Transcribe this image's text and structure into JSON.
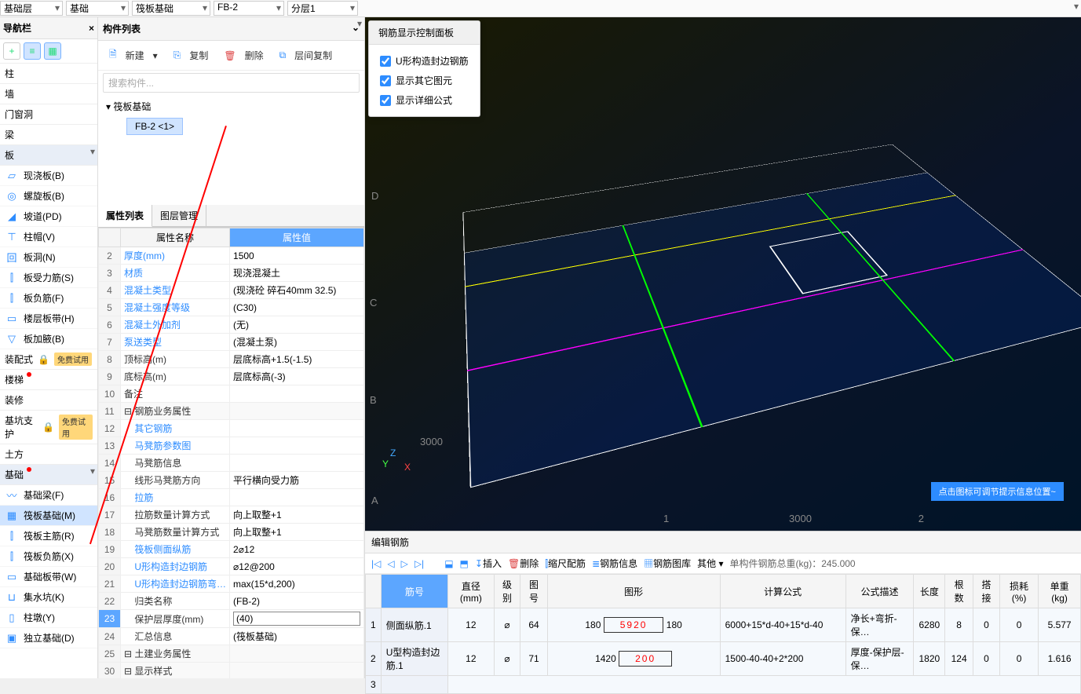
{
  "topbar": {
    "sel1": "基础层",
    "sel2": "基础",
    "sel3": "筏板基础",
    "sel4": "FB-2",
    "sel5": "分层1"
  },
  "nav": {
    "title": "导航栏",
    "cats": {
      "c0": "柱",
      "c1": "墙",
      "c2": "门窗洞",
      "c3": "梁",
      "c4": "板",
      "c5": "装配式",
      "c6": "楼梯",
      "c7": "装修",
      "c8": "基坑支护",
      "c9": "土方",
      "c10": "基础"
    },
    "free": "免费试用",
    "plates": {
      "p0": "现浇板(B)",
      "p1": "螺旋板(B)",
      "p2": "坡道(PD)",
      "p3": "柱帽(V)",
      "p4": "板洞(N)",
      "p5": "板受力筋(S)",
      "p6": "板负筋(F)",
      "p7": "楼层板带(H)",
      "p8": "板加腋(B)"
    },
    "found": {
      "f0": "基础梁(F)",
      "f1": "筏板基础(M)",
      "f2": "筏板主筋(R)",
      "f3": "筏板负筋(X)",
      "f4": "基础板带(W)",
      "f5": "集水坑(K)",
      "f6": "柱墩(Y)",
      "f7": "独立基础(D)"
    }
  },
  "list": {
    "title": "构件列表",
    "new": "新建",
    "copy": "复制",
    "del": "删除",
    "lcopy": "层间复制",
    "search": "搜索构件...",
    "root": "筏板基础",
    "leaf": "FB-2 <1>"
  },
  "prop": {
    "tab1": "属性列表",
    "tab2": "图层管理",
    "colname": "属性名称",
    "colval": "属性值",
    "rows": [
      {
        "n": "2",
        "name": "厚度(mm)",
        "val": "1500",
        "link": 1
      },
      {
        "n": "3",
        "name": "材质",
        "val": "现浇混凝土",
        "link": 1
      },
      {
        "n": "4",
        "name": "混凝土类型",
        "val": "(现浇砼 碎石40mm 32.5)",
        "link": 1
      },
      {
        "n": "5",
        "name": "混凝土强度等级",
        "val": "(C30)",
        "link": 1
      },
      {
        "n": "6",
        "name": "混凝土外加剂",
        "val": "(无)",
        "link": 1
      },
      {
        "n": "7",
        "name": "泵送类型",
        "val": "(混凝土泵)",
        "link": 1
      },
      {
        "n": "8",
        "name": "顶标高(m)",
        "val": "层底标高+1.5(-1.5)"
      },
      {
        "n": "9",
        "name": "底标高(m)",
        "val": "层底标高(-3)"
      },
      {
        "n": "10",
        "name": "备注",
        "val": ""
      },
      {
        "n": "11",
        "name": "钢筋业务属性",
        "val": "",
        "grp": 1
      },
      {
        "n": "12",
        "name": "其它钢筋",
        "val": "",
        "link": 1,
        "ind": 1
      },
      {
        "n": "13",
        "name": "马凳筋参数图",
        "val": "",
        "link": 1,
        "ind": 1
      },
      {
        "n": "14",
        "name": "马凳筋信息",
        "val": "",
        "ind": 1
      },
      {
        "n": "15",
        "name": "线形马凳筋方向",
        "val": "平行横向受力筋",
        "ind": 1
      },
      {
        "n": "16",
        "name": "拉筋",
        "val": "",
        "link": 1,
        "ind": 1
      },
      {
        "n": "17",
        "name": "拉筋数量计算方式",
        "val": "向上取整+1",
        "ind": 1
      },
      {
        "n": "18",
        "name": "马凳筋数量计算方式",
        "val": "向上取整+1",
        "ind": 1
      },
      {
        "n": "19",
        "name": "筏板侧面纵筋",
        "val": "2⌀12",
        "link": 1,
        "ind": 1
      },
      {
        "n": "20",
        "name": "U形构造封边钢筋",
        "val": "⌀12@200",
        "link": 1,
        "ind": 1
      },
      {
        "n": "21",
        "name": "U形构造封边钢筋弯…",
        "val": "max(15*d,200)",
        "link": 1,
        "ind": 1
      },
      {
        "n": "22",
        "name": "归类名称",
        "val": "(FB-2)",
        "ind": 1
      },
      {
        "n": "23",
        "name": "保护层厚度(mm)",
        "val": "(40)",
        "ind": 1,
        "sel": 1,
        "edit": 1
      },
      {
        "n": "24",
        "name": "汇总信息",
        "val": "(筏板基础)",
        "ind": 1
      },
      {
        "n": "25",
        "name": "土建业务属性",
        "val": "",
        "grp": 1
      },
      {
        "n": "30",
        "name": "显示样式",
        "val": "",
        "grp": 1
      }
    ]
  },
  "panel": {
    "title": "钢筋显示控制面板",
    "c1": "U形构造封边钢筋",
    "c2": "显示其它图元",
    "c3": "显示详细公式"
  },
  "hint": "点击图标可调节提示信息位置~",
  "axis": {
    "a": "A",
    "b": "B",
    "c": "C",
    "d": "D",
    "n1": "1",
    "n2": "2",
    "d1": "3000",
    "d2": "3000",
    "x": "X",
    "y": "Y",
    "z": "Z"
  },
  "btm": {
    "title": "编辑钢筋",
    "insert": "插入",
    "del": "删除",
    "scale": "缩尺配筋",
    "info": "钢筋信息",
    "lib": "钢筋图库",
    "other": "其他",
    "total_lbl": "单构件钢筋总重(kg)：",
    "total": "245.000",
    "cols": {
      "c0": "筋号",
      "c1": "直径(mm)",
      "c2": "级别",
      "c3": "图号",
      "c4": "图形",
      "c5": "计算公式",
      "c6": "公式描述",
      "c7": "长度",
      "c8": "根数",
      "c9": "搭接",
      "c10": "损耗(%)",
      "c11": "单重(kg)"
    },
    "r1": {
      "name": "侧面纵筋.1",
      "dia": "12",
      "lvl": "⌀",
      "tno": "64",
      "s1": "180",
      "sred": "5920",
      "s2": "180",
      "formula": "6000+15*d-40+15*d-40",
      "desc": "净长+弯折-保…",
      "len": "6280",
      "num": "8",
      "lap": "0",
      "loss": "0",
      "wt": "5.577"
    },
    "r2": {
      "name": "U型构造封边筋.1",
      "dia": "12",
      "lvl": "⌀",
      "tno": "71",
      "s1": "1420",
      "sred": "200",
      "formula": "1500-40-40+2*200",
      "desc": "厚度-保护层-保…",
      "len": "1820",
      "num": "124",
      "lap": "0",
      "loss": "0",
      "wt": "1.616"
    },
    "r3": "3"
  }
}
